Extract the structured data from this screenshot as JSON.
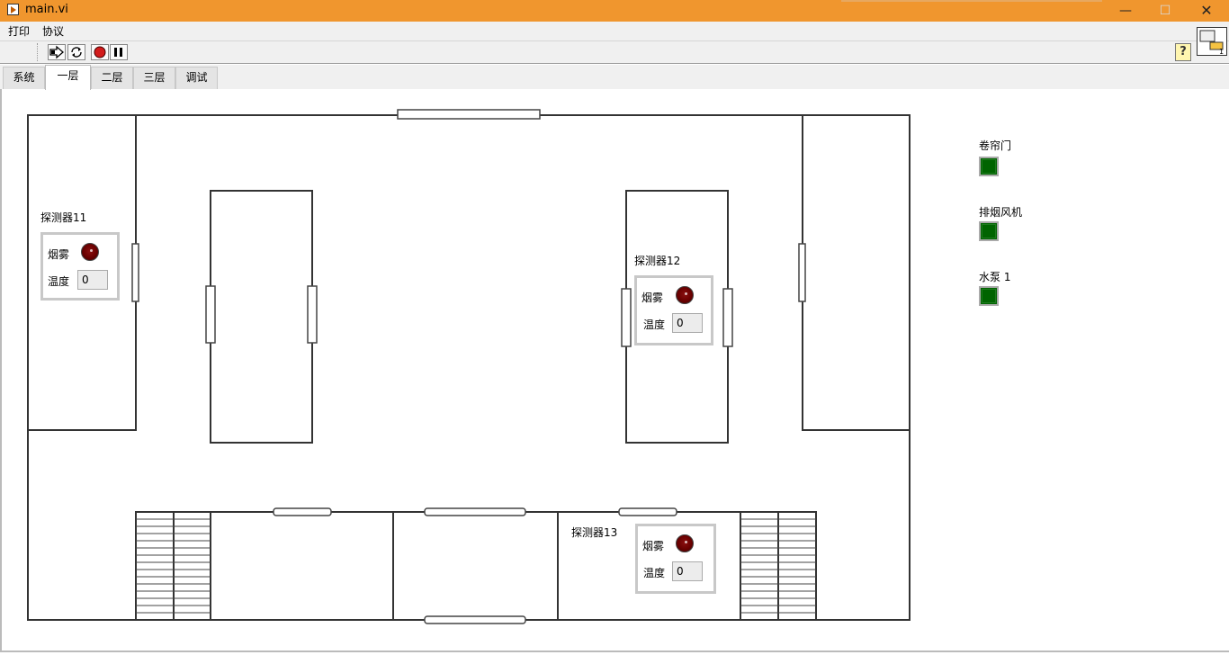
{
  "window": {
    "title": "main.vi",
    "minimize_glyph": "—",
    "maximize_glyph": "☐",
    "close_glyph": "✕"
  },
  "menu": {
    "items": [
      "打印",
      "协议"
    ]
  },
  "toolbar": {
    "buttons": [
      {
        "name": "run-arrow-icon",
        "glyph": "➡"
      },
      {
        "name": "run-continuous-icon",
        "glyph": "⟳"
      },
      {
        "name": "abort-icon",
        "glyph": "●"
      },
      {
        "name": "pause-icon",
        "glyph": "❚❚"
      }
    ],
    "help_glyph": "?"
  },
  "tabs": [
    {
      "label": "系统",
      "active": false
    },
    {
      "label": "一层",
      "active": true
    },
    {
      "label": "二层",
      "active": false
    },
    {
      "label": "三层",
      "active": false
    },
    {
      "label": "调试",
      "active": false
    }
  ],
  "detectors": [
    {
      "label": "探测器11",
      "smoke_label": "烟雾",
      "temp_label": "温度",
      "temp_value": "0"
    },
    {
      "label": "探测器12",
      "smoke_label": "烟雾",
      "temp_label": "温度",
      "temp_value": "0"
    },
    {
      "label": "探测器13",
      "smoke_label": "烟雾",
      "temp_label": "温度",
      "temp_value": "0"
    }
  ],
  "indicators": [
    {
      "label": "卷帘门",
      "color": "#006400"
    },
    {
      "label": "排烟风机",
      "color": "#006400"
    },
    {
      "label": "水泵 1",
      "color": "#006400"
    }
  ],
  "colors": {
    "title_bar": "#F0962E",
    "smoke_led": "#6a0000",
    "indicator_on": "#006400"
  }
}
